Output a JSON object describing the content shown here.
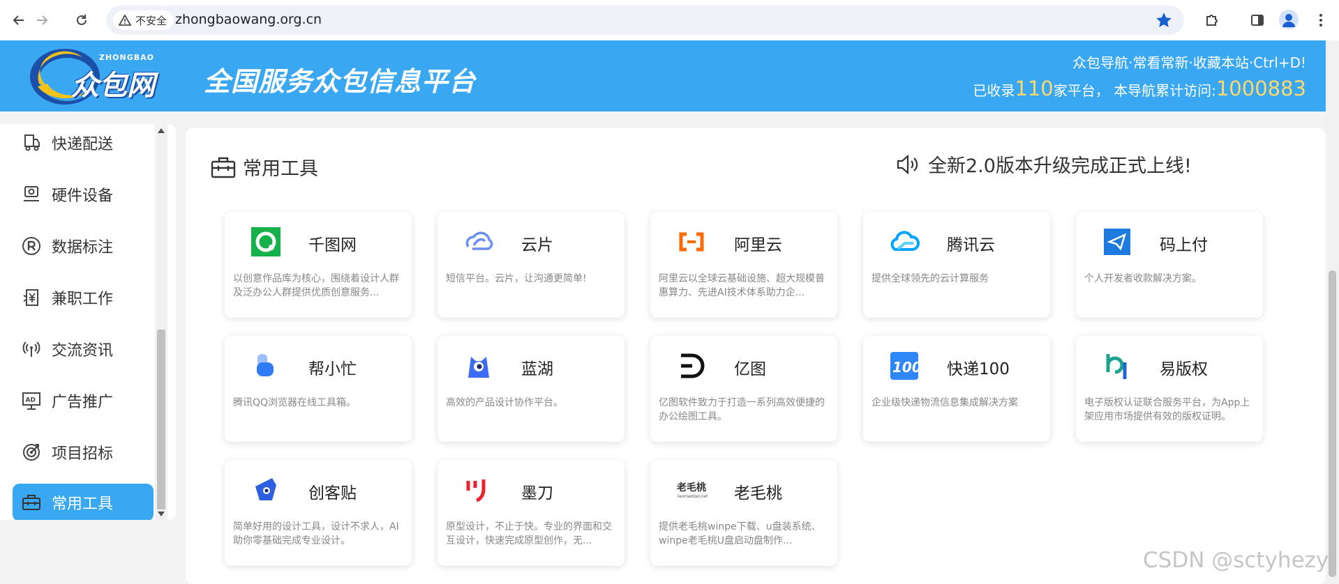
{
  "browser": {
    "security_label": "不安全",
    "url": "zhongbaowang.org.cn"
  },
  "header": {
    "logo_text": "众包网",
    "logo_sub": "ZHONGBAO",
    "slogan": "全国服务众包信息平台",
    "line1": "众包导航·常看常新·收藏本站·Ctrl+D!",
    "line2_prefix": "已收录",
    "platform_count": "110",
    "line2_mid": "家平台，  本导航累计访问:",
    "visit_count": "1000883"
  },
  "sidebar": {
    "items": [
      {
        "label": "快递配送",
        "icon": "delivery-icon"
      },
      {
        "label": "硬件设备",
        "icon": "hardware-icon"
      },
      {
        "label": "数据标注",
        "icon": "registered-icon"
      },
      {
        "label": "兼职工作",
        "icon": "parttime-icon"
      },
      {
        "label": "交流资讯",
        "icon": "broadcast-icon"
      },
      {
        "label": "广告推广",
        "icon": "ad-icon"
      },
      {
        "label": "项目招标",
        "icon": "target-icon"
      },
      {
        "label": "常用工具",
        "icon": "toolbox-icon"
      }
    ],
    "active_index": 7
  },
  "main": {
    "section_title": "常用工具",
    "notice": "全新2.0版本升级完成正式上线!",
    "cards": [
      {
        "name": "千图网",
        "desc": "以创意作品库为核心，围绕着设计人群及泛办公人群提供优质创意服务...",
        "icon": "qiantu-icon",
        "color": "#16b14a"
      },
      {
        "name": "云片",
        "desc": "短信平台。云片，让沟通更简单!",
        "icon": "yunpian-icon",
        "color": "#6b8ef5"
      },
      {
        "name": "阿里云",
        "desc": "阿里云以全球云基础设施、超大规模普惠算力、先进AI技术体系助力企...",
        "icon": "aliyun-icon",
        "color": "#ff6a00"
      },
      {
        "name": "腾讯云",
        "desc": "提供全球领先的云计算服务",
        "icon": "tencent-cloud-icon",
        "color": "#00a3ff"
      },
      {
        "name": "码上付",
        "desc": "个人开发者收款解决方案。",
        "icon": "mashangfu-icon",
        "color": "#1f7ae0"
      },
      {
        "name": "帮小忙",
        "desc": "腾讯QQ浏览器在线工具箱。",
        "icon": "bangxiaomang-icon",
        "color": "#2f7cf6"
      },
      {
        "name": "蓝湖",
        "desc": "高效的产品设计协作平台。",
        "icon": "lanhu-icon",
        "color": "#3d6cf5"
      },
      {
        "name": "亿图",
        "desc": "亿图软件致力于打造一系列高效便捷的办公绘图工具。",
        "icon": "yitu-icon",
        "color": "#111111"
      },
      {
        "name": "快递100",
        "desc": "企业级快递物流信息集成解决方案",
        "icon": "kuaidi100-icon",
        "color": "#2f86f6"
      },
      {
        "name": "易版权",
        "desc": "电子版权认证联合服务平台，为App上架应用市场提供有效的版权证明。",
        "icon": "yibanquan-icon",
        "color": "#1fa28f"
      },
      {
        "name": "创客贴",
        "desc": "简单好用的设计工具，设计不求人，AI助你零基础完成专业设计。",
        "icon": "chuangketie-icon",
        "color": "#2d5fe0"
      },
      {
        "name": "墨刀",
        "desc": "原型设计，不止于快。专业的界面和交互设计，快速完成原型创作，无...",
        "icon": "modao-icon",
        "color": "#e8232b"
      },
      {
        "name": "老毛桃",
        "desc": "提供老毛桃winpe下载、u盘装系统、winpe老毛桃U盘启动盘制作...",
        "icon": "laomaotao-icon",
        "color": "#333333"
      }
    ]
  },
  "watermark": "CSDN @sctyhezy",
  "colors": {
    "brand": "#3aa7f3",
    "highlight": "#ffd86b"
  }
}
